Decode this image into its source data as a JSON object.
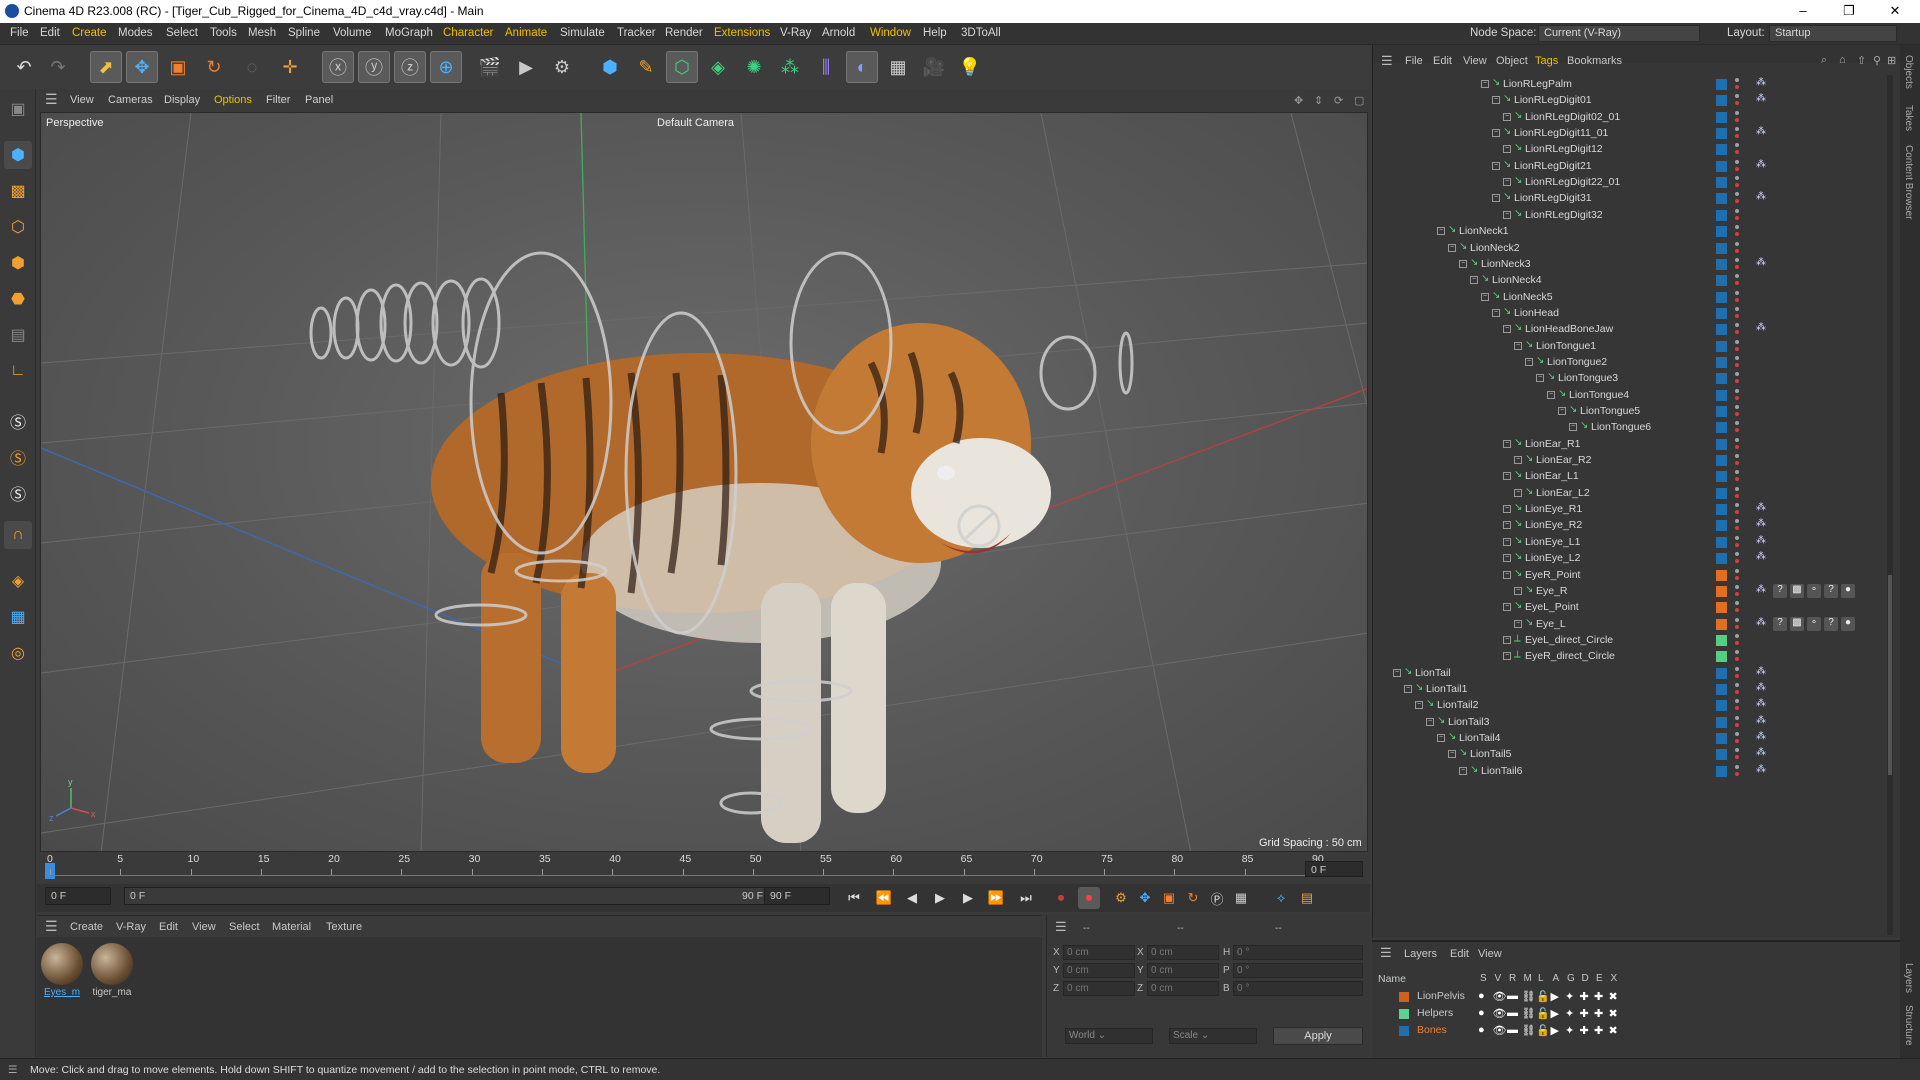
{
  "window": {
    "title": "Cinema 4D R23.008 (RC) - [Tiger_Cub_Rigged_for_Cinema_4D_c4d_vray.c4d] - Main"
  },
  "menubar": {
    "items": [
      "File",
      "Edit",
      "Create",
      "Modes",
      "Select",
      "Tools",
      "Mesh",
      "Spline",
      "Volume",
      "MoGraph",
      "Character",
      "Animate",
      "Simulate",
      "Tracker",
      "Render",
      "Extensions",
      "V-Ray",
      "Arnold",
      "Window",
      "Help",
      "3DToAll"
    ],
    "node_space_label": "Node Space:",
    "node_space_value": "Current (V-Ray)",
    "layout_label": "Layout:",
    "layout_value": "Startup"
  },
  "viewport": {
    "menu": [
      "View",
      "Cameras",
      "Display",
      "Options",
      "Filter",
      "Panel"
    ],
    "label": "Perspective",
    "camera": "Default Camera",
    "grid_spacing": "Grid Spacing : 50 cm"
  },
  "timeline": {
    "ticks": [
      "0",
      "5",
      "10",
      "15",
      "20",
      "25",
      "30",
      "35",
      "40",
      "45",
      "50",
      "55",
      "60",
      "65",
      "70",
      "75",
      "80",
      "85",
      "90"
    ],
    "current_frame": "0 F",
    "start_field": "0 F",
    "range_start": "0 F",
    "range_end": "90 F",
    "end_field": "90 F"
  },
  "materials": {
    "menu": [
      "Create",
      "V-Ray",
      "Edit",
      "View",
      "Select",
      "Material",
      "Texture"
    ],
    "items": [
      {
        "name": "Eyes_m"
      },
      {
        "name": "tiger_ma"
      }
    ]
  },
  "coords": {
    "header_a": "--",
    "header_b": "--",
    "header_c": "--",
    "rows": [
      {
        "l1": "X",
        "v1": "0 cm",
        "l2": "X",
        "v2": "0 cm",
        "l3": "H",
        "v3": "0 °"
      },
      {
        "l1": "Y",
        "v1": "0 cm",
        "l2": "Y",
        "v2": "0 cm",
        "l3": "P",
        "v3": "0 °"
      },
      {
        "l1": "Z",
        "v1": "0 cm",
        "l2": "Z",
        "v2": "0 cm",
        "l3": "B",
        "v3": "0 °"
      }
    ],
    "world": "World",
    "scale": "Scale",
    "apply": "Apply"
  },
  "status": {
    "text": "Move: Click and drag to move elements. Hold down SHIFT to quantize movement / add to the selection in point mode, CTRL to remove."
  },
  "object_manager": {
    "menu": [
      "File",
      "Edit",
      "View",
      "Object",
      "Tags",
      "Bookmarks"
    ],
    "rows": [
      {
        "name": "LionRLegPalm",
        "depth": 10,
        "tag": true
      },
      {
        "name": "LionRLegDigit01",
        "depth": 11,
        "tag": true
      },
      {
        "name": "LionRLegDigit02_01",
        "depth": 12,
        "tag": false
      },
      {
        "name": "LionRLegDigit11_01",
        "depth": 11,
        "tag": true
      },
      {
        "name": "LionRLegDigit12",
        "depth": 12,
        "tag": false
      },
      {
        "name": "LionRLegDigit21",
        "depth": 11,
        "tag": true
      },
      {
        "name": "LionRLegDigit22_01",
        "depth": 12,
        "tag": false
      },
      {
        "name": "LionRLegDigit31",
        "depth": 11,
        "tag": true
      },
      {
        "name": "LionRLegDigit32",
        "depth": 12,
        "tag": false
      },
      {
        "name": "LionNeck1",
        "depth": 6,
        "tag": false
      },
      {
        "name": "LionNeck2",
        "depth": 7,
        "tag": false
      },
      {
        "name": "LionNeck3",
        "depth": 8,
        "tag": true
      },
      {
        "name": "LionNeck4",
        "depth": 9,
        "tag": false
      },
      {
        "name": "LionNeck5",
        "depth": 10,
        "tag": false
      },
      {
        "name": "LionHead",
        "depth": 11,
        "tag": false
      },
      {
        "name": "LionHeadBoneJaw",
        "depth": 12,
        "tag": true
      },
      {
        "name": "LionTongue1",
        "depth": 13,
        "tag": false
      },
      {
        "name": "LionTongue2",
        "depth": 14,
        "tag": false
      },
      {
        "name": "LionTongue3",
        "depth": 15,
        "tag": false
      },
      {
        "name": "LionTongue4",
        "depth": 16,
        "tag": false
      },
      {
        "name": "LionTongue5",
        "depth": 17,
        "tag": false
      },
      {
        "name": "LionTongue6",
        "depth": 18,
        "tag": false
      },
      {
        "name": "LionEar_R1",
        "depth": 12,
        "tag": false
      },
      {
        "name": "LionEar_R2",
        "depth": 13,
        "tag": false
      },
      {
        "name": "LionEar_L1",
        "depth": 12,
        "tag": false
      },
      {
        "name": "LionEar_L2",
        "depth": 13,
        "tag": false
      },
      {
        "name": "LionEye_R1",
        "depth": 12,
        "tag": true
      },
      {
        "name": "LionEye_R2",
        "depth": 12,
        "tag": true
      },
      {
        "name": "LionEye_L1",
        "depth": 12,
        "tag": true
      },
      {
        "name": "LionEye_L2",
        "depth": 12,
        "tag": true
      },
      {
        "name": "EyeR_Point",
        "depth": 12,
        "tag": false,
        "color": "#e07020"
      },
      {
        "name": "Eye_R",
        "depth": 13,
        "tag": true,
        "color": "#e07020",
        "mats": true
      },
      {
        "name": "EyeL_Point",
        "depth": 12,
        "tag": false,
        "color": "#e07020"
      },
      {
        "name": "Eye_L",
        "depth": 13,
        "tag": true,
        "color": "#e07020",
        "mats": true
      },
      {
        "name": "EyeL_direct_Circle",
        "depth": 12,
        "tag": false,
        "color": "#50d080"
      },
      {
        "name": "EyeR_direct_Circle",
        "depth": 12,
        "tag": false,
        "color": "#50d080"
      },
      {
        "name": "LionTail",
        "depth": 2,
        "tag": true
      },
      {
        "name": "LionTail1",
        "depth": 3,
        "tag": true
      },
      {
        "name": "LionTail2",
        "depth": 4,
        "tag": true
      },
      {
        "name": "LionTail3",
        "depth": 5,
        "tag": true
      },
      {
        "name": "LionTail4",
        "depth": 6,
        "tag": true
      },
      {
        "name": "LionTail5",
        "depth": 7,
        "tag": true
      },
      {
        "name": "LionTail6",
        "depth": 8,
        "tag": true
      }
    ]
  },
  "layers": {
    "menu": [
      "Layers",
      "Edit",
      "View"
    ],
    "header_name": "Name",
    "header_cols": [
      "S",
      "V",
      "R",
      "M",
      "L",
      "A",
      "G",
      "D",
      "E",
      "X"
    ],
    "rows": [
      {
        "name": "LionPelvis",
        "color": "#d06020",
        "active": false
      },
      {
        "name": "Helpers",
        "color": "#60d090",
        "active": false
      },
      {
        "name": "Bones",
        "color": "#1e6fb0",
        "active": true
      }
    ]
  },
  "side_tabs": [
    "Objects",
    "Takes",
    "Content Browser",
    "Layers",
    "Structure"
  ]
}
